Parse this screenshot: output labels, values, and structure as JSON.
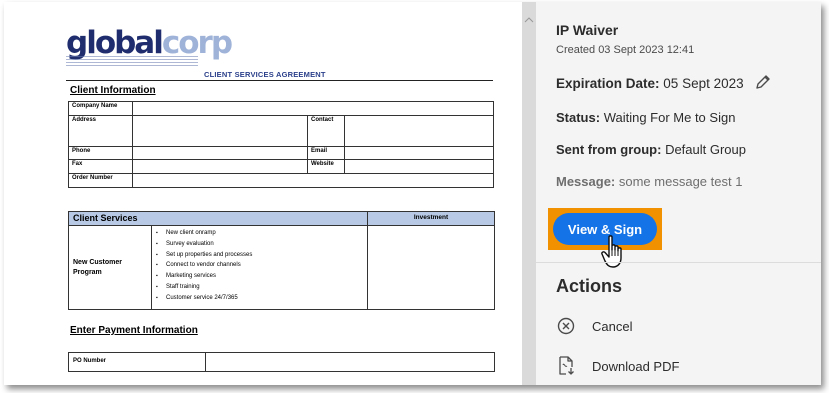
{
  "document": {
    "logo_part1": "global",
    "logo_part2": "corp",
    "title": "CLIENT SERVICES AGREEMENT",
    "client_information": {
      "heading": "Client Information",
      "company_name": "Company Name",
      "address": "Address",
      "contact": "Contact",
      "phone": "Phone",
      "email": "Email",
      "fax": "Fax",
      "website": "Website",
      "order_number": "Order Number"
    },
    "client_services": {
      "heading": "Client Services",
      "investment": "Investment",
      "program": "New Customer Program",
      "items": [
        "New client onramp",
        "Survey evaluation",
        "Set up properties and processes",
        "Connect to vendor channels",
        "Marketing services",
        "Staff training",
        "Customer service 24/7/365"
      ]
    },
    "payment": {
      "heading": "Enter Payment Information",
      "po_number": "PO Number"
    }
  },
  "panel": {
    "agreement_name": "IP Waiver",
    "created": "Created 03 Sept 2023 12:41",
    "expiration_label": "Expiration Date:",
    "expiration_value": "05 Sept 2023",
    "status_label": "Status:",
    "status_value": "Waiting For Me to Sign",
    "group_label": "Sent from group:",
    "group_value": "Default Group",
    "message_label": "Message:",
    "message_value": "some message test 1",
    "view_sign_button": "View & Sign",
    "actions_title": "Actions",
    "actions": [
      {
        "label": "Cancel",
        "icon": "cancel-circle-icon"
      },
      {
        "label": "Download PDF",
        "icon": "download-pdf-icon"
      }
    ]
  },
  "colors": {
    "accent_blue": "#1473e6",
    "highlight_orange": "#f29100",
    "panel_bg": "#f4f4f4",
    "table_header_blue": "#b7c9e4"
  }
}
